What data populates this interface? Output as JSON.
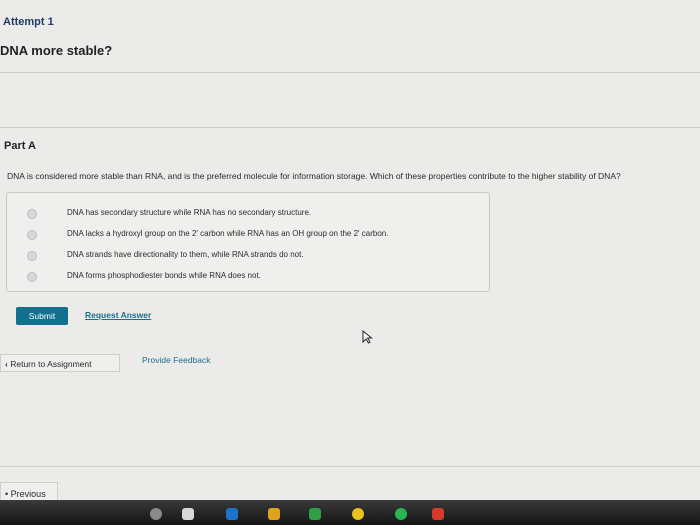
{
  "header": {
    "attempt": "Attempt 1",
    "title": "DNA more stable?"
  },
  "part": {
    "label": "Part A",
    "question": "DNA is considered more stable than RNA, and is the preferred molecule for information storage. Which of these properties contribute to the higher stability of DNA?",
    "options": [
      "DNA has secondary structure while RNA has no secondary structure.",
      "DNA lacks a hydroxyl group on the 2' carbon while RNA has an OH group on the 2' carbon.",
      "DNA strands have directionality to them, while RNA strands do not.",
      "DNA forms phosphodiester bonds while RNA does not."
    ]
  },
  "actions": {
    "submit": "Submit",
    "request_answer": "Request Answer",
    "return": "Return to Assignment",
    "feedback": "Provide Feedback",
    "previous": "Previous"
  },
  "icons": {
    "return": "chevron-left-icon",
    "previous": "bullet-icon",
    "cursor": "mouse-pointer-icon"
  },
  "colors": {
    "submit_bg": "#12708f",
    "link": "#1a6f8c",
    "page_bg": "#ebebe9"
  }
}
